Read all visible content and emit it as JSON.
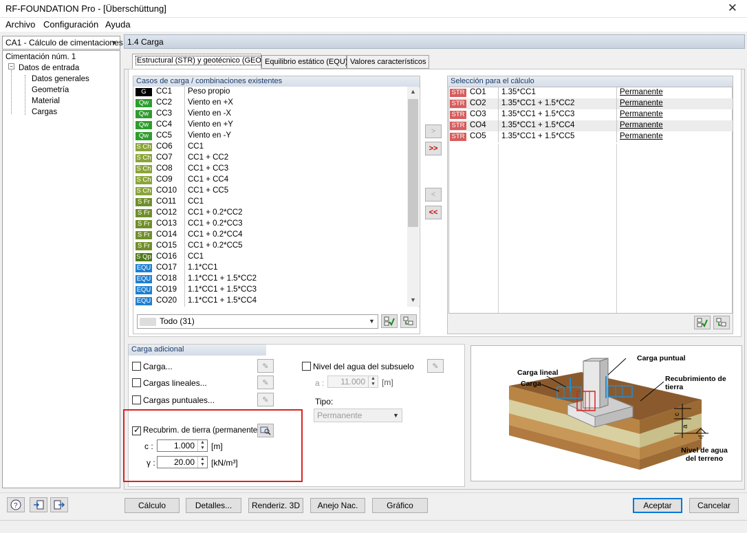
{
  "window": {
    "title": "RF-FOUNDATION Pro - [Überschüttung]",
    "close": "✕"
  },
  "menu": [
    "Archivo",
    "Configuración",
    "Ayuda"
  ],
  "case_selector": "CA1 - Cálculo de cimentaciones",
  "tree": {
    "root": "Cimentación núm. 1",
    "group": "Datos de entrada",
    "items": [
      "Datos generales",
      "Geometría",
      "Material",
      "Cargas"
    ]
  },
  "section_title": "1.4 Carga",
  "tabs": [
    "Estructural (STR) y geotécnico (GEO)",
    "Equilibrio estático (EQU)",
    "Valores característicos"
  ],
  "existing": {
    "header": "Casos de carga / combinaciones existentes",
    "rows": [
      {
        "badge": "G",
        "code": "CC1",
        "desc": "Peso propio"
      },
      {
        "badge": "Qw",
        "code": "CC2",
        "desc": "Viento en +X"
      },
      {
        "badge": "Qw",
        "code": "CC3",
        "desc": "Viento en -X"
      },
      {
        "badge": "Qw",
        "code": "CC4",
        "desc": "Viento en +Y"
      },
      {
        "badge": "Qw",
        "code": "CC5",
        "desc": "Viento en -Y"
      },
      {
        "badge": "S Ch",
        "code": "CO6",
        "desc": "CC1"
      },
      {
        "badge": "S Ch",
        "code": "CO7",
        "desc": "CC1 + CC2"
      },
      {
        "badge": "S Ch",
        "code": "CO8",
        "desc": "CC1 + CC3"
      },
      {
        "badge": "S Ch",
        "code": "CO9",
        "desc": "CC1 + CC4"
      },
      {
        "badge": "S Ch",
        "code": "CO10",
        "desc": "CC1 + CC5"
      },
      {
        "badge": "S Fr",
        "code": "CO11",
        "desc": "CC1"
      },
      {
        "badge": "S Fr",
        "code": "CO12",
        "desc": "CC1 + 0.2*CC2"
      },
      {
        "badge": "S Fr",
        "code": "CO13",
        "desc": "CC1 + 0.2*CC3"
      },
      {
        "badge": "S Fr",
        "code": "CO14",
        "desc": "CC1 + 0.2*CC4"
      },
      {
        "badge": "S Fr",
        "code": "CO15",
        "desc": "CC1 + 0.2*CC5"
      },
      {
        "badge": "S Qp",
        "code": "CO16",
        "desc": "CC1"
      },
      {
        "badge": "EQU",
        "code": "CO17",
        "desc": "1.1*CC1"
      },
      {
        "badge": "EQU",
        "code": "CO18",
        "desc": "1.1*CC1 + 1.5*CC2"
      },
      {
        "badge": "EQU",
        "code": "CO19",
        "desc": "1.1*CC1 + 1.5*CC3"
      },
      {
        "badge": "EQU",
        "code": "CO20",
        "desc": "1.1*CC1 + 1.5*CC4"
      }
    ],
    "filter": "Todo (31)"
  },
  "selected": {
    "header": "Selección para el cálculo",
    "rows": [
      {
        "badge": "STR",
        "code": "CO1",
        "combo": "1.35*CC1",
        "type": "Permanente"
      },
      {
        "badge": "STR",
        "code": "CO2",
        "combo": "1.35*CC1 + 1.5*CC2",
        "type": "Permanente"
      },
      {
        "badge": "STR",
        "code": "CO3",
        "combo": "1.35*CC1 + 1.5*CC3",
        "type": "Permanente"
      },
      {
        "badge": "STR",
        "code": "CO4",
        "combo": "1.35*CC1 + 1.5*CC4",
        "type": "Permanente"
      },
      {
        "badge": "STR",
        "code": "CO5",
        "combo": "1.35*CC1 + 1.5*CC5",
        "type": "Permanente"
      }
    ]
  },
  "transfer": {
    "add": ">",
    "add_all": ">>",
    "remove": "<",
    "remove_all": "<<"
  },
  "additional": {
    "header": "Carga adicional",
    "carga": "Carga...",
    "cargas_lineales": "Cargas lineales...",
    "cargas_puntuales": "Cargas puntuales...",
    "recubrimiento": "Recubrim. de tierra (permanente)",
    "c_label": "c :",
    "c_value": "1.000",
    "c_unit": "[m]",
    "gamma_label": "γ :",
    "gamma_value": "20.00",
    "gamma_unit": "[kN/m³]",
    "nivel_agua": "Nivel del agua del subsuelo",
    "a_label": "a :",
    "a_value": "11.000",
    "a_unit": "[m]",
    "tipo_label": "Tipo:",
    "tipo_value": "Permanente"
  },
  "illustration": {
    "carga_puntual": "Carga puntual",
    "carga_lineal": "Carga lineal",
    "carga": "Carga",
    "recubrimiento": "Recubrimiento de tierra",
    "c": "c",
    "a": "a",
    "nivel": "Nivel de agua del terreno"
  },
  "footer": {
    "calculo": "Cálculo",
    "detalles": "Detalles...",
    "renderiz": "Renderiz. 3D",
    "anejo": "Anejo Nac.",
    "grafico": "Gráfico",
    "aceptar": "Aceptar",
    "cancelar": "Cancelar"
  },
  "colors": {
    "G": "#000000",
    "Qw": "#2e9d2e",
    "S Ch": "#8aa53a",
    "S Fr": "#6f8f2a",
    "S Qp": "#4f7a1a",
    "EQU": "#1f7fd0",
    "STR": "#d85c5c",
    "highlight": "#d9221f"
  }
}
